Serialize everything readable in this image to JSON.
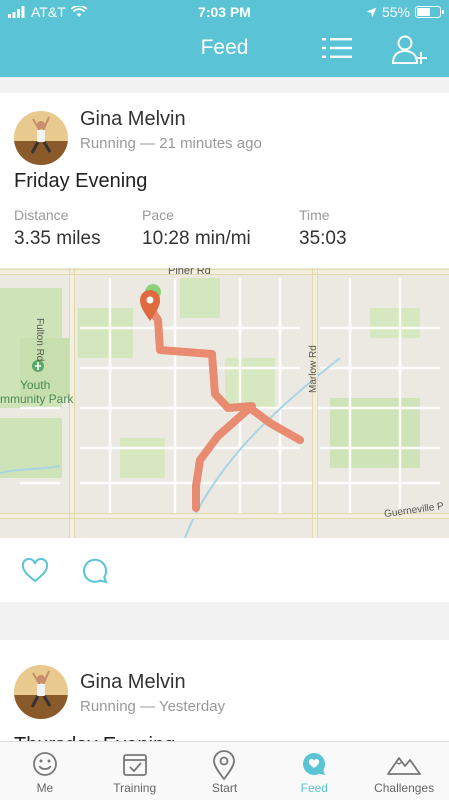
{
  "status_bar": {
    "carrier": "AT&T",
    "time": "7:03 PM",
    "battery": "55%"
  },
  "header": {
    "title": "Feed",
    "list_icon": "list-icon",
    "add_user_icon": "add-user-icon"
  },
  "posts": [
    {
      "author": "Gina Melvin",
      "subtitle": "Running — 21 minutes ago",
      "title": "Friday Evening",
      "stats": [
        {
          "label": "Distance",
          "value": "3.35 miles"
        },
        {
          "label": "Pace",
          "value": "10:28 min/mi"
        },
        {
          "label": "Time",
          "value": "35:03"
        }
      ],
      "map": {
        "labels": {
          "piner": "Piner Rd",
          "fulton": "Fulton Rd",
          "marlow": "Marlow Rd",
          "guerneville": "Guerneville P",
          "park1": "Youth",
          "park2": "mmunity Park"
        }
      }
    },
    {
      "author": "Gina Melvin",
      "subtitle": "Running — Yesterday",
      "title": "Thursday Evening"
    }
  ],
  "tabs": [
    {
      "label": "Me",
      "icon": "smiley-icon"
    },
    {
      "label": "Training",
      "icon": "calendar-check-icon"
    },
    {
      "label": "Start",
      "icon": "location-pin-icon"
    },
    {
      "label": "Feed",
      "icon": "feed-chat-icon"
    },
    {
      "label": "Challenges",
      "icon": "mountains-icon"
    }
  ],
  "colors": {
    "accent": "#5ac4d6",
    "route": "#e8866a",
    "pin": "#e06a3f"
  }
}
